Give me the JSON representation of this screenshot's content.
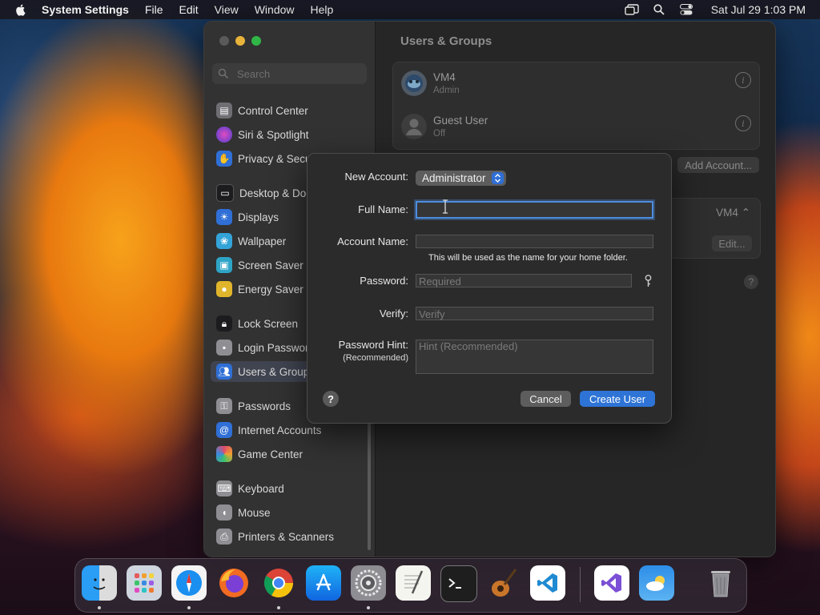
{
  "menubar": {
    "app_name": "System Settings",
    "menus": [
      "File",
      "Edit",
      "View",
      "Window",
      "Help"
    ],
    "clock": "Sat Jul 29  1:03 PM"
  },
  "sidebar": {
    "search_placeholder": "Search",
    "items": [
      {
        "label": "Control Center",
        "icon": "control-center-icon",
        "color": "#6e6e73"
      },
      {
        "label": "Siri & Spotlight",
        "icon": "siri-icon",
        "color": "#9b3fd1"
      },
      {
        "label": "Privacy & Security",
        "icon": "hand-icon",
        "color": "#2f6fd6"
      },
      {
        "label": "Desktop & Dock",
        "icon": "dock-icon",
        "color": "#1c1c1e"
      },
      {
        "label": "Displays",
        "icon": "sun-icon",
        "color": "#2f6fd6"
      },
      {
        "label": "Wallpaper",
        "icon": "wallpaper-icon",
        "color": "#34a3d8"
      },
      {
        "label": "Screen Saver",
        "icon": "screen-saver-icon",
        "color": "#2ea4c6"
      },
      {
        "label": "Energy Saver",
        "icon": "bulb-icon",
        "color": "#e0b52b"
      },
      {
        "label": "Lock Screen",
        "icon": "lock-icon",
        "color": "#1c1c1e"
      },
      {
        "label": "Login Password",
        "icon": "password-icon",
        "color": "#8e8e93"
      },
      {
        "label": "Users & Groups",
        "icon": "users-icon",
        "color": "#2f6fd6"
      },
      {
        "label": "Passwords",
        "icon": "key-icon",
        "color": "#8e8e93"
      },
      {
        "label": "Internet Accounts",
        "icon": "at-icon",
        "color": "#2f6fd6"
      },
      {
        "label": "Game Center",
        "icon": "game-center-icon",
        "color": "#e9e9e9"
      },
      {
        "label": "Keyboard",
        "icon": "keyboard-icon",
        "color": "#8e8e93"
      },
      {
        "label": "Mouse",
        "icon": "mouse-icon",
        "color": "#8e8e93"
      },
      {
        "label": "Printers & Scanners",
        "icon": "printer-icon",
        "color": "#8e8e93"
      }
    ]
  },
  "content": {
    "title": "Users & Groups",
    "users": [
      {
        "name": "VM4",
        "role": "Admin"
      },
      {
        "name": "Guest User",
        "role": "Off"
      }
    ],
    "add_account_label": "Add Account...",
    "auto_login_value": "VM4",
    "edit_label": "Edit...",
    "help_label": "?"
  },
  "sheet": {
    "new_account_label": "New Account:",
    "new_account_value": "Administrator",
    "full_name_label": "Full Name:",
    "full_name_value": "",
    "account_name_label": "Account Name:",
    "account_name_value": "",
    "account_name_hint": "This will be used as the name for your home folder.",
    "password_label": "Password:",
    "password_placeholder": "Required",
    "verify_label": "Verify:",
    "verify_placeholder": "Verify",
    "hint_label": "Password Hint:",
    "hint_sub": "(Recommended)",
    "hint_placeholder": "Hint (Recommended)",
    "help_label": "?",
    "cancel_label": "Cancel",
    "create_label": "Create User"
  },
  "dock": {
    "apps": [
      "Finder",
      "Launchpad",
      "Safari",
      "Firefox",
      "Chrome",
      "App Store",
      "System Settings",
      "TextEdit",
      "Terminal",
      "GarageBand",
      "Visual Studio Code",
      "Visual Studio",
      "Weather",
      "Trash"
    ]
  },
  "colors": {
    "accent": "#2e74d6",
    "focus_ring": "#4d8ddf",
    "close": "#5a5a5a",
    "minimize": "#e8b33a",
    "zoom": "#2fb646"
  }
}
